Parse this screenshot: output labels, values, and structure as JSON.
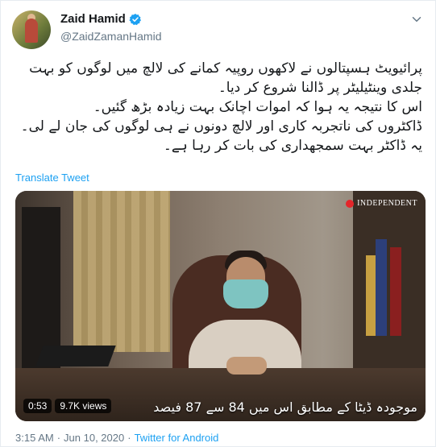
{
  "user": {
    "name": "Zaid Hamid",
    "handle": "@ZaidZamanHamid",
    "verified": true
  },
  "tweet": {
    "lines": [
      "پرائیویٹ ہسپتالوں نے لاکھوں روپیہ کمانے کی لالچ میں لوگوں کو بہت جلدی وینٹیلیٹر پر ڈالنا شروع کر دیا۔",
      "اس کا نتیجہ یہ ہوا کہ اموات اچانک بہت زیادہ بڑھ گئیں۔",
      "ڈاکٹروں کی ناتجربہ کاری اور لالچ دونوں نے ہی لوگوں کی جان لے لی۔",
      "یہ ڈاکٹر بہت سمجھداری کی بات کر رہا ہے۔"
    ],
    "translate_label": "Translate Tweet"
  },
  "video": {
    "duration": "0:53",
    "views": "9.7K views",
    "caption": "موجودہ ڈیٹا کے مطابق اس میں 84 سے 87 فیصد",
    "watermark": "INDEPENDENT"
  },
  "meta": {
    "time": "3:15 AM",
    "separator": "·",
    "date": "Jun 10, 2020",
    "source": "Twitter for Android"
  },
  "colors": {
    "accent": "#1da1f2",
    "secondary_text": "#657786"
  },
  "icons": {
    "verified": "verified-badge-icon",
    "menu": "chevron-down-icon"
  }
}
